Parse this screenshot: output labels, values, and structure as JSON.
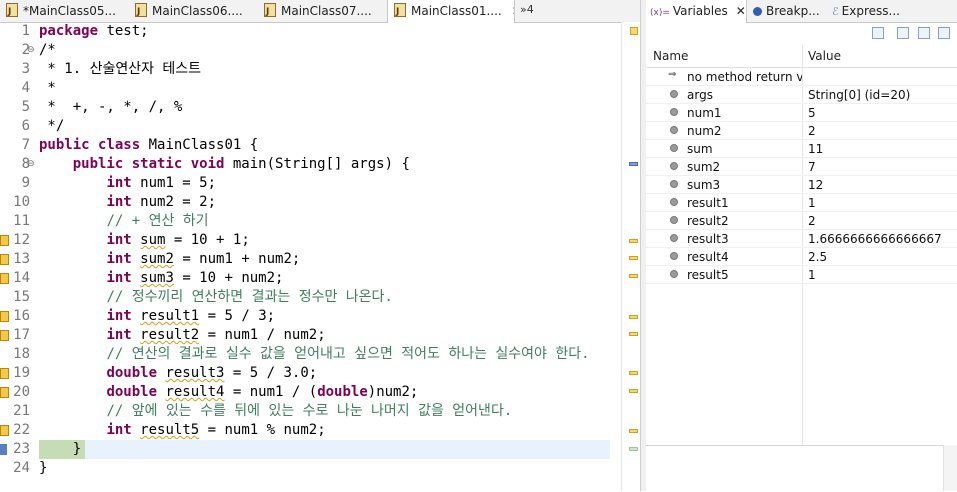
{
  "editor": {
    "tabs": [
      {
        "label": "*MainClass05...",
        "active": false
      },
      {
        "label": "MainClass06....",
        "active": false
      },
      {
        "label": "MainClass07....",
        "active": false
      },
      {
        "label": "MainClass01....",
        "active": true
      }
    ],
    "close_glyph": "✕",
    "overflow_label": "»4",
    "lines": [
      {
        "n": "1"
      },
      {
        "n": "2"
      },
      {
        "n": "3"
      },
      {
        "n": "4"
      },
      {
        "n": "5"
      },
      {
        "n": "6"
      },
      {
        "n": "7"
      },
      {
        "n": "8"
      },
      {
        "n": "9"
      },
      {
        "n": "10"
      },
      {
        "n": "11"
      },
      {
        "n": "12"
      },
      {
        "n": "13"
      },
      {
        "n": "14"
      },
      {
        "n": "15"
      },
      {
        "n": "16"
      },
      {
        "n": "17"
      },
      {
        "n": "18"
      },
      {
        "n": "19"
      },
      {
        "n": "20"
      },
      {
        "n": "21"
      },
      {
        "n": "22"
      },
      {
        "n": "23"
      },
      {
        "n": "24"
      }
    ],
    "code": {
      "l1_kw": "package",
      "l1_rest": " test;",
      "l2": "/*",
      "l3": " * 1. 산술연산자 테스트",
      "l4": " *",
      "l5": " *  +, -, *, /, %",
      "l6": " */",
      "l7_kw": "public class",
      "l7_rest": " MainClass01 {",
      "l8_kw": "public static void",
      "l8_rest": " main(String[] args) {",
      "l9_kw": "int",
      "l9_rest": " num1 = 5;",
      "l10_kw": "int",
      "l10_rest": " num2 = 2;",
      "l11": "// + 연산 하기",
      "l12_kw": "int",
      "l12_var": "sum",
      "l12_rest": " = 10 + 1;",
      "l13_kw": "int",
      "l13_var": "sum2",
      "l13_rest": " = num1 + num2;",
      "l14_kw": "int",
      "l14_var": "sum3",
      "l14_rest": " = 10 + num2;",
      "l15": "// 정수끼리 연산하면 결과는 정수만 나온다.",
      "l16_kw": "int",
      "l16_var": "result1",
      "l16_rest": " = 5 / 3;",
      "l17_kw": "int",
      "l17_var": "result2",
      "l17_rest": " = num1 / num2;",
      "l18": "// 연산의 결과로 실수 값을 얻어내고 싶으면 적어도 하나는 실수여야 한다.",
      "l19_kw": "double",
      "l19_var": "result3",
      "l19_rest": " = 5 / 3.0;",
      "l20_kw": "double",
      "l20_var": "result4",
      "l20_mid": " = num1 / (",
      "l20_kw2": "double",
      "l20_rest": ")num2;",
      "l21": "// 앞에 있는 수를 뒤에 있는 수로 나눈 나머지 값을 얻어낸다.",
      "l22_kw": "int",
      "l22_var": "result5",
      "l22_rest": " = num1 % num2;",
      "l23": "}",
      "l24": "}"
    }
  },
  "variables_view": {
    "tabs": [
      {
        "label": "Variables",
        "prefix": "(x)=",
        "active": true
      },
      {
        "label": "Breakp...",
        "active": false
      },
      {
        "label": "Express...",
        "active": false
      }
    ],
    "close_glyph": "✕",
    "columns": {
      "name": "Name",
      "value": "Value"
    },
    "rows": [
      {
        "name": "no method return val",
        "value": "",
        "icon": "return-icon"
      },
      {
        "name": "args",
        "value": "String[0]  (id=20)",
        "icon": "local-variable-icon"
      },
      {
        "name": "num1",
        "value": "5",
        "icon": "local-variable-icon"
      },
      {
        "name": "num2",
        "value": "2",
        "icon": "local-variable-icon"
      },
      {
        "name": "sum",
        "value": "11",
        "icon": "local-variable-icon"
      },
      {
        "name": "sum2",
        "value": "7",
        "icon": "local-variable-icon"
      },
      {
        "name": "sum3",
        "value": "12",
        "icon": "local-variable-icon"
      },
      {
        "name": "result1",
        "value": "1",
        "icon": "local-variable-icon"
      },
      {
        "name": "result2",
        "value": "2",
        "icon": "local-variable-icon"
      },
      {
        "name": "result3",
        "value": "1.6666666666666667",
        "icon": "local-variable-icon"
      },
      {
        "name": "result4",
        "value": "2.5",
        "icon": "local-variable-icon"
      },
      {
        "name": "result5",
        "value": "1",
        "icon": "local-variable-icon"
      }
    ]
  }
}
